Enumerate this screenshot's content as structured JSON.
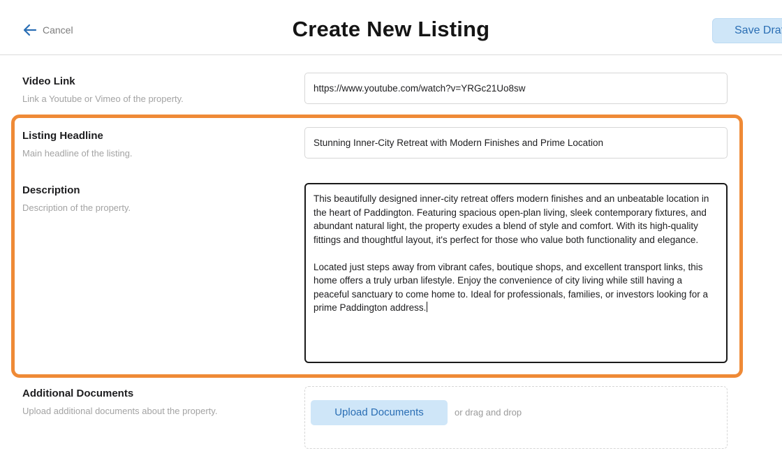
{
  "header": {
    "cancel_label": "Cancel",
    "title": "Create New Listing",
    "save_label": "Save Draft"
  },
  "fields": {
    "video_link": {
      "label": "Video Link",
      "help": "Link a Youtube or Vimeo of the property.",
      "value": "https://www.youtube.com/watch?v=YRGc21Uo8sw"
    },
    "headline": {
      "label": "Listing Headline",
      "help": "Main headline of the listing.",
      "value": "Stunning Inner-City Retreat with Modern Finishes and Prime Location"
    },
    "description": {
      "label": "Description",
      "help": "Description of the property.",
      "paragraph_1": "This beautifully designed inner-city retreat offers modern finishes and an unbeatable location in the heart of Paddington. Featuring spacious open-plan living, sleek contemporary fixtures, and abundant natural light, the property exudes a blend of style and comfort. With its high-quality fittings and thoughtful layout, it's perfect for those who value both functionality and elegance.",
      "paragraph_2": "Located just steps away from vibrant cafes, boutique shops, and excellent transport links, this home offers a truly urban lifestyle. Enjoy the convenience of city living while still having a peaceful sanctuary to come home to. Ideal for professionals, families, or investors looking for a prime Paddington address."
    },
    "documents": {
      "label": "Additional Documents",
      "help": "Upload additional documents about the property.",
      "upload_label": "Upload Documents",
      "drag_text": "or drag and drop"
    }
  },
  "colors": {
    "highlight": "#ef8a36",
    "accent": "#2a6eb4",
    "button_bg": "#cfe6f8"
  },
  "icons": {
    "back": "arrow-left-icon"
  }
}
